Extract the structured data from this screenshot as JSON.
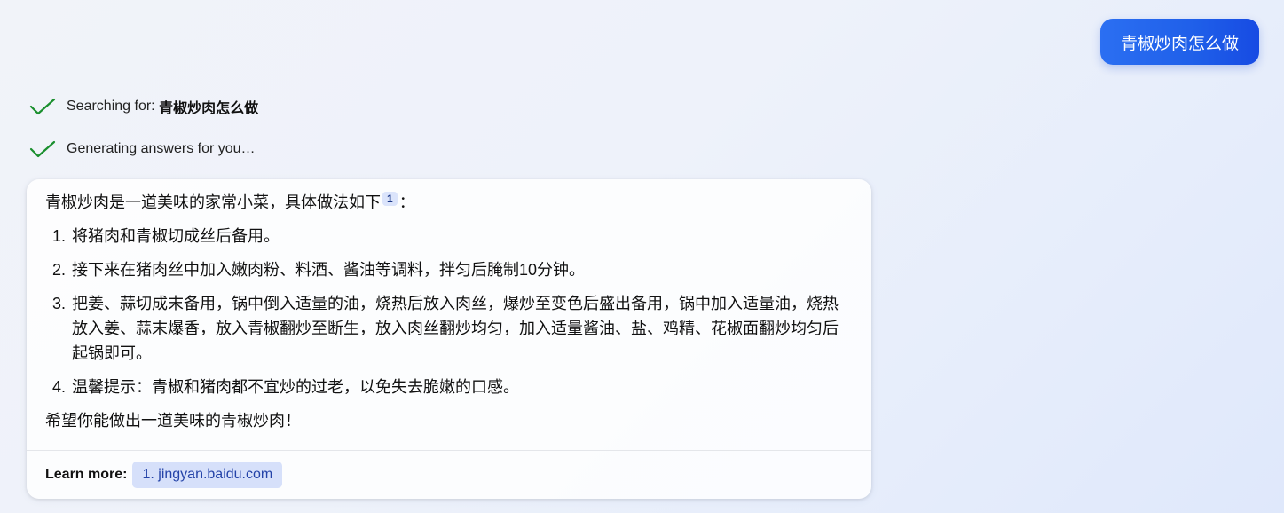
{
  "user_message": "青椒炒肉怎么做",
  "status": {
    "searching_prefix": "Searching for: ",
    "searching_query": "青椒炒肉怎么做",
    "generating": "Generating answers for you…",
    "icon": "checkmark-icon",
    "icon_color": "#1a8f2e"
  },
  "answer": {
    "intro": "青椒炒肉是一道美味的家常小菜，具体做法如下",
    "citation": "1",
    "intro_suffix": "：",
    "steps": [
      {
        "num": "1.",
        "text": "将猪肉和青椒切成丝后备用。"
      },
      {
        "num": "2.",
        "text": "接下来在猪肉丝中加入嫩肉粉、料酒、酱油等调料，拌匀后腌制10分钟。"
      },
      {
        "num": "3.",
        "text": "把姜、蒜切成末备用，锅中倒入适量的油，烧热后放入肉丝，爆炒至变色后盛出备用，锅中加入适量油，烧热放入姜、蒜末爆香，放入青椒翻炒至断生，放入肉丝翻炒均匀，加入适量酱油、盐、鸡精、花椒面翻炒均匀后起锅即可。"
      },
      {
        "num": "4.",
        "text": "温馨提示：青椒和猪肉都不宜炒的过老，以免失去脆嫩的口感。"
      }
    ],
    "outro": "希望你能做出一道美味的青椒炒肉！"
  },
  "learn_more": {
    "label": "Learn more:",
    "links": [
      "1. jingyan.baidu.com"
    ]
  },
  "colors": {
    "user_bubble": "#1f5fe9",
    "citation_bg": "#dbe4fb",
    "link_bg": "#d6e0fa"
  }
}
